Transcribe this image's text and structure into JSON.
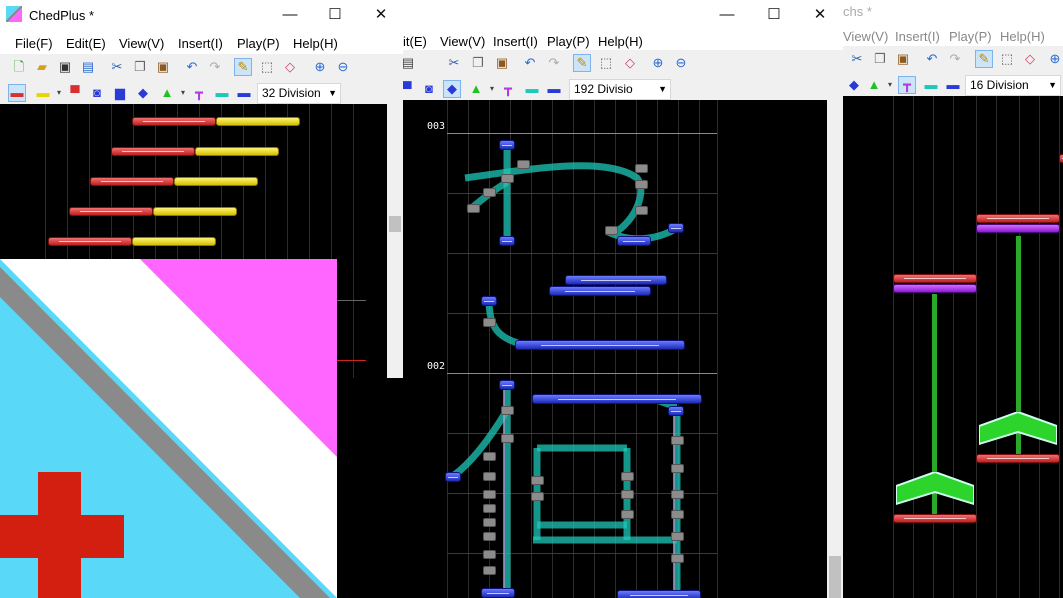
{
  "app": {
    "title": "ChedPlus *",
    "title_right": "chs *"
  },
  "window_controls": {
    "minimize": "—",
    "maximize": "☐",
    "close": "✕"
  },
  "menus_left": [
    "File(F)",
    "Edit(E)",
    "View(V)",
    "Insert(I)",
    "Play(P)",
    "Help(H)"
  ],
  "menus_middle": [
    "Edit(E)",
    "View(V)",
    "Insert(I)",
    "Play(P)",
    "Help(H)"
  ],
  "menus_right": [
    "View(V)",
    "Insert(I)",
    "Play(P)",
    "Help(H)"
  ],
  "menus_middle_partial": {
    "edit": "it(E)"
  },
  "menus_right_partial": {
    "view": "View(V)"
  },
  "division": {
    "left": "32 Division",
    "middle": "192 Divisio",
    "right": "16 Division"
  },
  "measures": {
    "m003": "003",
    "m002": "002"
  },
  "toolbar_icons": [
    "new-icon",
    "open-icon",
    "save-icon",
    "export-icon",
    "cut-icon",
    "copy-icon",
    "paste-icon",
    "undo-icon",
    "redo-icon",
    "pen-icon",
    "select-icon",
    "eraser-icon",
    "zoom-in-icon",
    "zoom-out-icon"
  ],
  "note_tool_icons": [
    "tap-note-icon",
    "extap-note-icon",
    "flick-note-icon",
    "damage-note-icon",
    "hold-note-icon",
    "slide-note-icon",
    "airaction-note-icon",
    "air-up-icon",
    "air-down-icon",
    "hold-step-icon",
    "slide-step-icon"
  ],
  "colors": {
    "tap": "#d83030",
    "extap": "#e8d400",
    "slide": "#2a3ad6",
    "slide_path": "#1ec8b8",
    "air": "#b33ae0",
    "air_action": "#1fc21f",
    "sky": "#5ad8f8",
    "pink": "#ff66ff",
    "cross": "#d21f10"
  }
}
